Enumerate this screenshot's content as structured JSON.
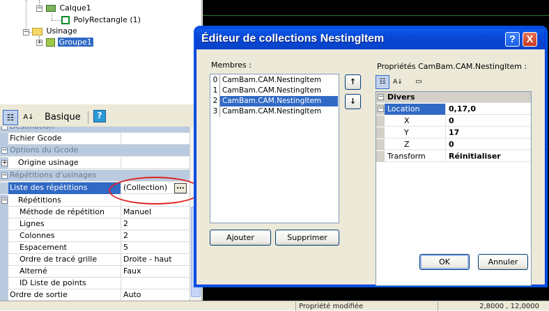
{
  "tree": {
    "items": [
      {
        "label": "Calque1"
      },
      {
        "label": "PolyRectangle (1)"
      },
      {
        "label": "Usinage"
      },
      {
        "label": "Groupe1"
      }
    ]
  },
  "prop_toolbar": {
    "view_label": "Basique",
    "help_label": "?"
  },
  "property_grid": {
    "rows": [
      {
        "type": "category",
        "name": "Destination"
      },
      {
        "type": "prop",
        "name": "Fichier Gcode",
        "value": ""
      },
      {
        "type": "category",
        "name": "Options du Gcode"
      },
      {
        "type": "prop",
        "name": "Origine usinage",
        "value": ""
      },
      {
        "type": "category",
        "name": "Répétitions d'usinages"
      },
      {
        "type": "prop",
        "name": "Liste des répétitions",
        "value": "(Collection)"
      },
      {
        "type": "prop",
        "name": "Répétitions",
        "value": ""
      },
      {
        "type": "prop",
        "name": "Méthode de répétition",
        "value": "Manuel"
      },
      {
        "type": "prop",
        "name": "Lignes",
        "value": "2"
      },
      {
        "type": "prop",
        "name": "Colonnes",
        "value": "2"
      },
      {
        "type": "prop",
        "name": "Espacement",
        "value": "5"
      },
      {
        "type": "prop",
        "name": "Ordre de tracé grille",
        "value": "Droite - haut"
      },
      {
        "type": "prop",
        "name": "Alterné",
        "value": "Faux"
      },
      {
        "type": "prop",
        "name": "ID Liste de points",
        "value": ""
      },
      {
        "type": "prop",
        "name": "Ordre de sortie",
        "value": "Auto"
      }
    ],
    "ellipsis_label": "..."
  },
  "statusbar": {
    "message": "Propriété modifiée",
    "coords": "2,8000 , 12,0000"
  },
  "dialog": {
    "title": "Éditeur de collections NestingItem",
    "help_label": "?",
    "close_label": "X",
    "members_label": "Membres :",
    "members": [
      {
        "index": "0",
        "label": "CamBam.CAM.NestingItem"
      },
      {
        "index": "1",
        "label": "CamBam.CAM.NestingItem"
      },
      {
        "index": "2",
        "label": "CamBam.CAM.NestingItem"
      },
      {
        "index": "3",
        "label": "CamBam.CAM.NestingItem"
      }
    ],
    "move_up_label": "↑",
    "move_down_label": "↓",
    "add_label": "Ajouter",
    "remove_label": "Supprimer",
    "properties_label": "Propriétés  CamBam.CAM.NestingItem  :",
    "props": [
      {
        "type": "category",
        "name": "Divers",
        "value": ""
      },
      {
        "type": "prop",
        "name": "Location",
        "value": "0,17,0"
      },
      {
        "type": "sub",
        "name": "X",
        "value": "0"
      },
      {
        "type": "sub",
        "name": "Y",
        "value": "17"
      },
      {
        "type": "sub",
        "name": "Z",
        "value": "0"
      },
      {
        "type": "prop",
        "name": "Transform",
        "value": "Réinitialiser"
      }
    ],
    "ok_label": "OK",
    "cancel_label": "Annuler"
  }
}
